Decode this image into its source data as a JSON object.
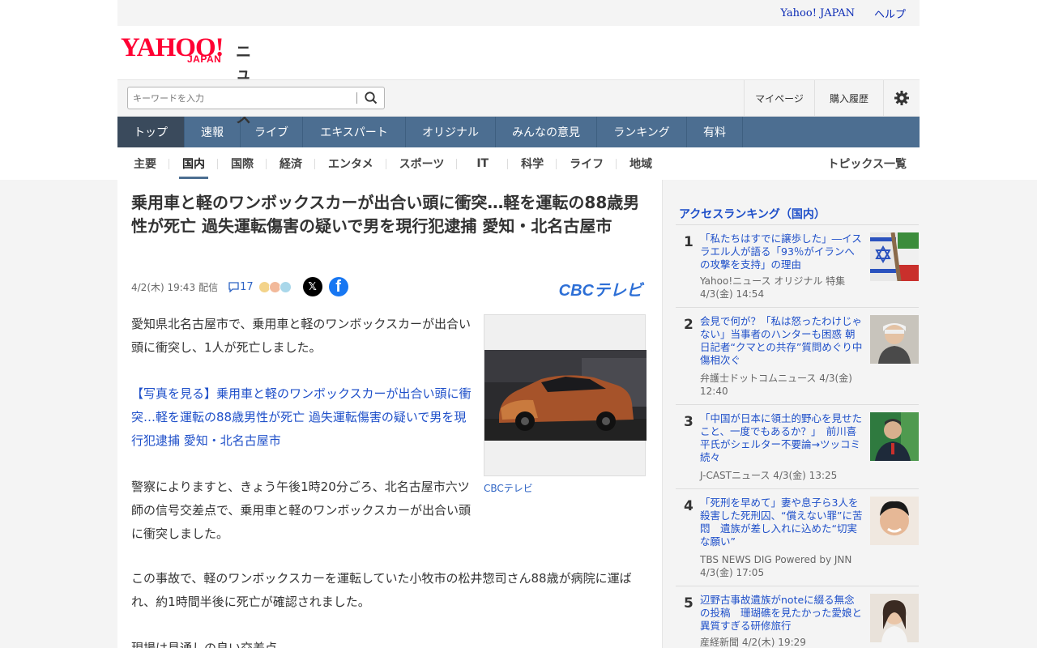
{
  "util": {
    "yahoo_japan": "Yahoo! JAPAN",
    "help": "ヘルプ"
  },
  "logo": {
    "main": "YAHOO!",
    "sub": "JAPAN",
    "service": "ニュース"
  },
  "search": {
    "placeholder": "キーワードを入力"
  },
  "account_links": {
    "mypage": "マイページ",
    "history": "購入履歴"
  },
  "main_nav": [
    "トップ",
    "速報",
    "ライブ",
    "エキスパート",
    "オリジナル",
    "みんなの意見",
    "ランキング",
    "有料"
  ],
  "sub_nav": [
    "主要",
    "国内",
    "国際",
    "経済",
    "エンタメ",
    "スポーツ",
    "IT",
    "科学",
    "ライフ",
    "地域"
  ],
  "sub_nav_right": "トピックス一覧",
  "article": {
    "title": "乗用車と軽のワンボックスカーが出合い頭に衝突…軽を運転の88歳男性が死亡 過失運転傷害の疑いで男を現行犯逮捕 愛知・北名古屋市",
    "date": "4/2(木) 19:43",
    "delivery": "配信",
    "comment_count": "17",
    "publisher_logo": "CBCテレビ",
    "paragraph1": "愛知県北名古屋市で、乗用車と軽のワンボックスカーが出合い頭に衝突し、1人が死亡しました。",
    "photo_link": "【写真を見る】乗用車と軽のワンボックスカーが出合い頭に衝突…軽を運転の88歳男性が死亡 過失運転傷害の疑いで男を現行犯逮捕 愛知・北名古屋市",
    "paragraph2": "警察によりますと、きょう午後1時20分ごろ、北名古屋市六ツ師の信号交差点で、乗用車と軽のワンボックスカーが出合い頭に衝突しました。",
    "paragraph3": "この事故で、軽のワンボックスカーを運転していた小牧市の松井惣司さん88歳が病院に運ばれ、約1時間半後に死亡が確認されました。",
    "paragraph4": "現場は見通しの良い交差点",
    "photo_caption": "CBCテレビ"
  },
  "ranking": {
    "title": "アクセスランキング（国内）",
    "items": [
      {
        "rank": "1",
        "title": "「私たちはすでに譲歩した」―イスラエル人が語る「93％がイランへの攻撃を支持」の理由",
        "source": "Yahoo!ニュース オリジナル 特集",
        "date": "4/3(金) 14:54"
      },
      {
        "rank": "2",
        "title": "会見で何が？「私は怒ったわけじゃない」当事者のハンターも困惑 朝日記者“クマとの共存”質問めぐり中傷相次ぐ",
        "source": "弁護士ドットコムニュース 4/3(金)",
        "date": "12:40"
      },
      {
        "rank": "3",
        "title": "「中国が日本に領土的野心を見せたこと、一度でもあるか？」　前川喜平氏がシェルター不要論→ツッコミ続々",
        "source": "J-CASTニュース 4/3(金) 13:25",
        "date": ""
      },
      {
        "rank": "4",
        "title": "「死刑を早めて」妻や息子ら3人を殺害した死刑囚、“償えない罪”に苦悶　遺族が差し入れに込めた“切実な願い”",
        "source": "TBS NEWS DIG Powered by JNN",
        "date": "4/3(金) 17:05"
      },
      {
        "rank": "5",
        "title": "辺野古事故遺族がnoteに綴る無念の投稿　珊瑚礁を見たかった愛娘と異質すぎる研修旅行",
        "source": "産経新聞 4/2(木) 19:29",
        "date": ""
      }
    ]
  },
  "colors": {
    "nav_bg": "#4c6e91",
    "link": "#1e4fc9",
    "brand_red": "#ff0033"
  }
}
